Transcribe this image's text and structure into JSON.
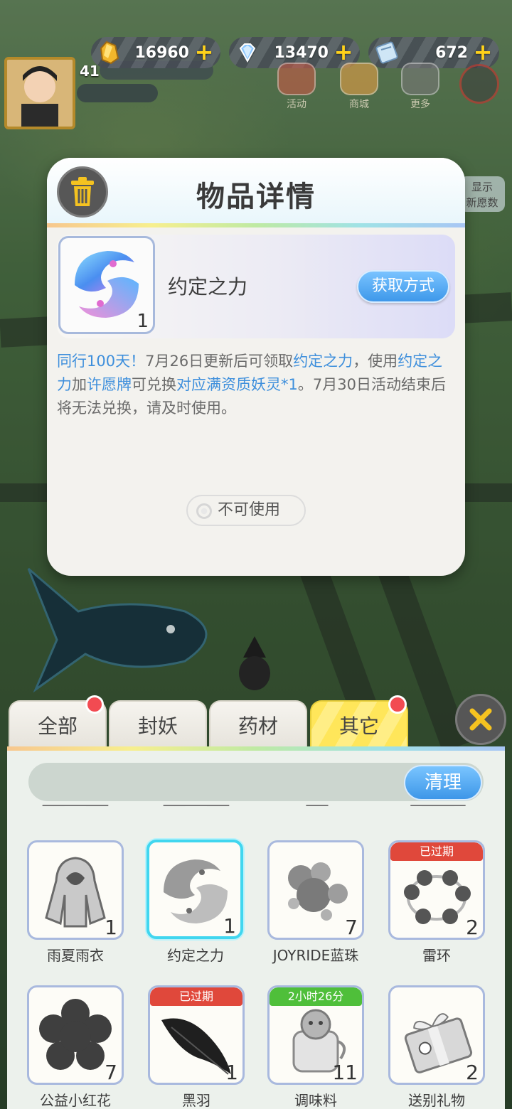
{
  "hud": {
    "currencies": [
      {
        "icon": "gold-crystal-icon",
        "value": "16960"
      },
      {
        "icon": "diamond-icon",
        "value": "13470"
      },
      {
        "icon": "ticket-icon",
        "value": "672"
      }
    ],
    "plus": "+",
    "level": "41",
    "buttons": [
      {
        "label": "活动"
      },
      {
        "label": "商城"
      },
      {
        "label": "更多"
      }
    ],
    "side_banner": "显示\n新愿数"
  },
  "dialog": {
    "title": "物品详情",
    "item": {
      "name": "约定之力",
      "qty": "1"
    },
    "get_way": "获取方式",
    "desc": [
      {
        "t": "同行100天！",
        "hl": true
      },
      {
        "t": "7月26日更新后可领取",
        "hl": false
      },
      {
        "t": "约定之力",
        "hl": true
      },
      {
        "t": "，使用",
        "hl": false
      },
      {
        "t": "约定之力",
        "hl": true
      },
      {
        "t": "加",
        "hl": false
      },
      {
        "t": "许愿牌",
        "hl": true
      },
      {
        "t": "可兑换",
        "hl": false
      },
      {
        "t": "对应满资质妖灵*1",
        "hl": true
      },
      {
        "t": "。7月30日活动结束后将无法兑换，请及时使用。",
        "hl": false
      }
    ],
    "unusable": "不可使用"
  },
  "bag": {
    "tabs": [
      {
        "label": "全部",
        "active": false,
        "dot": true
      },
      {
        "label": "封妖",
        "active": false,
        "dot": false
      },
      {
        "label": "药材",
        "active": false,
        "dot": false
      },
      {
        "label": "其它",
        "active": true,
        "dot": true
      }
    ],
    "clean": "清理",
    "items": [
      {
        "name": "雨夏雨衣",
        "qty": "1",
        "icon": "raincoat-icon",
        "badge": ""
      },
      {
        "name": "约定之力",
        "qty": "1",
        "icon": "promise-orb-icon",
        "badge": "",
        "selected": true
      },
      {
        "name": "JOYRIDE蓝珠",
        "qty": "7",
        "icon": "bubble-pearls-icon",
        "badge": ""
      },
      {
        "name": "雷环",
        "qty": "2",
        "icon": "thunder-ring-icon",
        "badge": "已过期"
      },
      {
        "name": "公益小红花",
        "qty": "7",
        "icon": "flower-icon",
        "badge": ""
      },
      {
        "name": "黑羽",
        "qty": "1",
        "icon": "black-feather-icon",
        "badge": "已过期"
      },
      {
        "name": "调味料",
        "qty": "11",
        "icon": "seasoning-jar-icon",
        "badge": "2小时26分"
      },
      {
        "name": "送别礼物",
        "qty": "2",
        "icon": "gift-box-icon",
        "badge": ""
      }
    ]
  },
  "colors": {
    "accent_blue": "#3e8fdc",
    "badge_red": "#e0483b",
    "badge_green": "#4fbf3a",
    "active_tab": "#ffe65a",
    "selected_border": "#41d6ef"
  }
}
